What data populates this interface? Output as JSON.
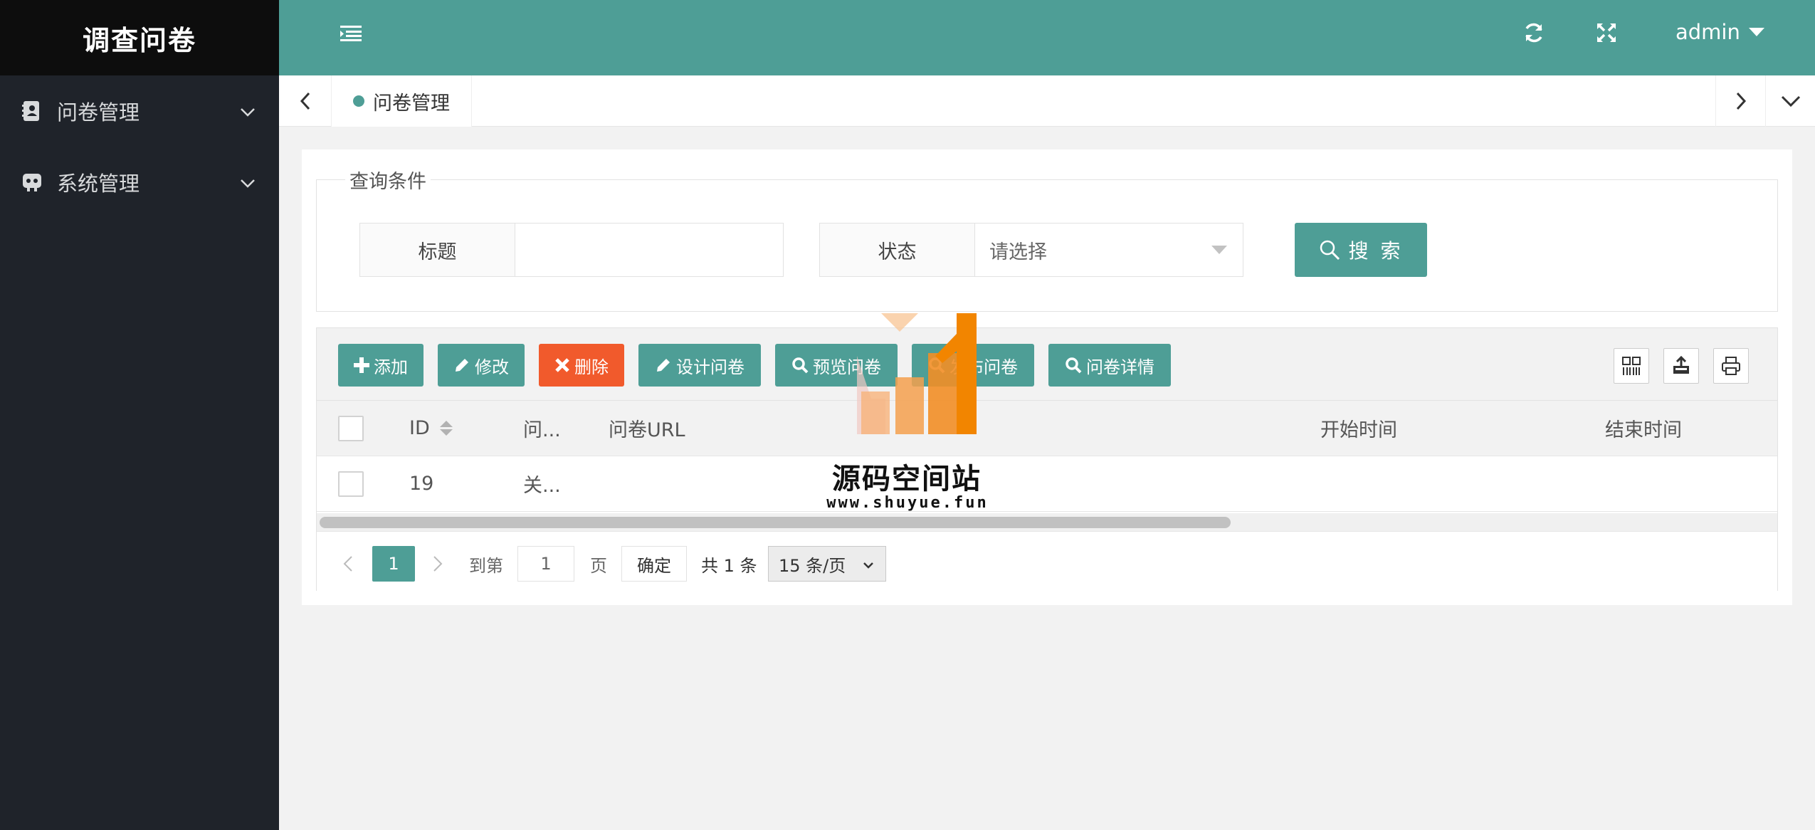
{
  "app": {
    "title": "调查问卷",
    "user": "admin"
  },
  "sidebar": {
    "items": [
      {
        "label": "问卷管理",
        "icon": "contacts-icon"
      },
      {
        "label": "系统管理",
        "icon": "settings-robot-icon"
      }
    ]
  },
  "tabs": {
    "active": "问卷管理"
  },
  "search": {
    "legend": "查询条件",
    "title_label": "标题",
    "title_value": "",
    "status_label": "状态",
    "status_placeholder": "请选择",
    "button": "搜 索"
  },
  "toolbar": {
    "add": "添加",
    "edit": "修改",
    "delete": "删除",
    "design": "设计问卷",
    "preview": "预览问卷",
    "publish": "发布问卷",
    "detail": "问卷详情"
  },
  "table": {
    "columns": [
      "ID",
      "问...",
      "问卷URL",
      "开始时间",
      "结束时间"
    ],
    "rows": [
      {
        "id": "19",
        "title": "关...",
        "url": "",
        "start": "",
        "end": ""
      }
    ]
  },
  "pager": {
    "current": "1",
    "goto_label": "到第",
    "goto_value": "1",
    "page_unit": "页",
    "confirm": "确定",
    "total": "共 1 条",
    "page_size": "15 条/页"
  },
  "watermark": {
    "name": "源码空间站",
    "url": "www.shuyue.fun"
  },
  "colors": {
    "primary": "#4e9e96",
    "danger": "#f15a2c",
    "sidebar": "#1f232a",
    "logo_bg": "#0d0d0d"
  }
}
